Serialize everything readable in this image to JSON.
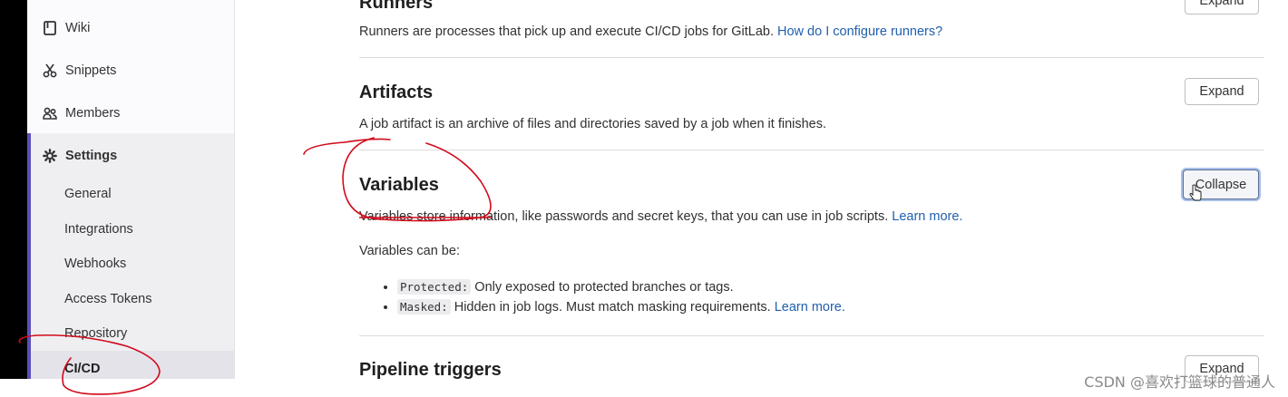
{
  "sidebar": {
    "items": [
      {
        "label": "Wiki",
        "icon": "book-icon"
      },
      {
        "label": "Snippets",
        "icon": "scissors-icon"
      },
      {
        "label": "Members",
        "icon": "users-icon"
      },
      {
        "label": "Settings",
        "icon": "gear-icon"
      }
    ],
    "settings_subitems": [
      "General",
      "Integrations",
      "Webhooks",
      "Access Tokens",
      "Repository",
      "CI/CD"
    ]
  },
  "sections": {
    "runners": {
      "title": "Runners",
      "desc": "Runners are processes that pick up and execute CI/CD jobs for GitLab.",
      "link": "How do I configure runners?",
      "button": "Expand"
    },
    "artifacts": {
      "title": "Artifacts",
      "desc": "A job artifact is an archive of files and directories saved by a job when it finishes.",
      "button": "Expand"
    },
    "variables": {
      "title": "Variables",
      "desc": "Variables store information, like passwords and secret keys, that you can use in job scripts.",
      "link": "Learn more.",
      "button": "Collapse",
      "can_be": "Variables can be:",
      "list": [
        {
          "code": "Protected:",
          "text": "Only exposed to protected branches or tags."
        },
        {
          "code": "Masked:",
          "text": "Hidden in job logs. Must match masking requirements.",
          "link": "Learn more."
        }
      ]
    },
    "pipeline_triggers": {
      "title": "Pipeline triggers",
      "button": "Expand"
    }
  },
  "watermark": "CSDN @喜欢打篮球的普通人",
  "colors": {
    "accent": "#5b4fb8",
    "link": "#1f5fae",
    "annotation": "#d10a1a"
  }
}
